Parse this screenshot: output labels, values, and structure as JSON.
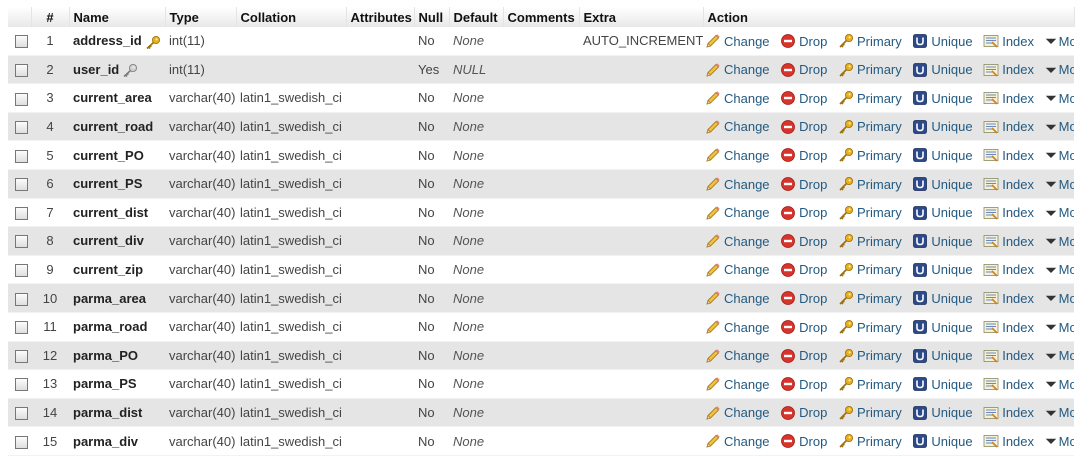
{
  "columns": {
    "num": "#",
    "name": "Name",
    "type": "Type",
    "collation": "Collation",
    "attributes": "Attributes",
    "null": "Null",
    "default": "Default",
    "comments": "Comments",
    "extra": "Extra",
    "action": "Action"
  },
  "actions": {
    "change": "Change",
    "drop": "Drop",
    "primary": "Primary",
    "unique": "Unique",
    "index": "Index",
    "more": "More"
  },
  "rows": [
    {
      "num": "1",
      "name": "address_id",
      "type": "int(11)",
      "collation": "",
      "null": "No",
      "default": "None",
      "extra": "AUTO_INCREMENT",
      "key": "primary"
    },
    {
      "num": "2",
      "name": "user_id",
      "type": "int(11)",
      "collation": "",
      "null": "Yes",
      "default": "NULL",
      "extra": "",
      "key": "index"
    },
    {
      "num": "3",
      "name": "current_area",
      "type": "varchar(40)",
      "collation": "latin1_swedish_ci",
      "null": "No",
      "default": "None",
      "extra": "",
      "key": ""
    },
    {
      "num": "4",
      "name": "current_road",
      "type": "varchar(40)",
      "collation": "latin1_swedish_ci",
      "null": "No",
      "default": "None",
      "extra": "",
      "key": ""
    },
    {
      "num": "5",
      "name": "current_PO",
      "type": "varchar(40)",
      "collation": "latin1_swedish_ci",
      "null": "No",
      "default": "None",
      "extra": "",
      "key": ""
    },
    {
      "num": "6",
      "name": "current_PS",
      "type": "varchar(40)",
      "collation": "latin1_swedish_ci",
      "null": "No",
      "default": "None",
      "extra": "",
      "key": ""
    },
    {
      "num": "7",
      "name": "current_dist",
      "type": "varchar(40)",
      "collation": "latin1_swedish_ci",
      "null": "No",
      "default": "None",
      "extra": "",
      "key": ""
    },
    {
      "num": "8",
      "name": "current_div",
      "type": "varchar(40)",
      "collation": "latin1_swedish_ci",
      "null": "No",
      "default": "None",
      "extra": "",
      "key": ""
    },
    {
      "num": "9",
      "name": "current_zip",
      "type": "varchar(40)",
      "collation": "latin1_swedish_ci",
      "null": "No",
      "default": "None",
      "extra": "",
      "key": ""
    },
    {
      "num": "10",
      "name": "parma_area",
      "type": "varchar(40)",
      "collation": "latin1_swedish_ci",
      "null": "No",
      "default": "None",
      "extra": "",
      "key": ""
    },
    {
      "num": "11",
      "name": "parma_road",
      "type": "varchar(40)",
      "collation": "latin1_swedish_ci",
      "null": "No",
      "default": "None",
      "extra": "",
      "key": ""
    },
    {
      "num": "12",
      "name": "parma_PO",
      "type": "varchar(40)",
      "collation": "latin1_swedish_ci",
      "null": "No",
      "default": "None",
      "extra": "",
      "key": ""
    },
    {
      "num": "13",
      "name": "parma_PS",
      "type": "varchar(40)",
      "collation": "latin1_swedish_ci",
      "null": "No",
      "default": "None",
      "extra": "",
      "key": ""
    },
    {
      "num": "14",
      "name": "parma_dist",
      "type": "varchar(40)",
      "collation": "latin1_swedish_ci",
      "null": "No",
      "default": "None",
      "extra": "",
      "key": ""
    },
    {
      "num": "15",
      "name": "parma_div",
      "type": "varchar(40)",
      "collation": "latin1_swedish_ci",
      "null": "No",
      "default": "None",
      "extra": "",
      "key": ""
    }
  ],
  "colors": {
    "link": "#235a81",
    "row_alt": "#e5e5e5",
    "key_gold": "#e8b020",
    "drop_red": "#d9342b"
  }
}
